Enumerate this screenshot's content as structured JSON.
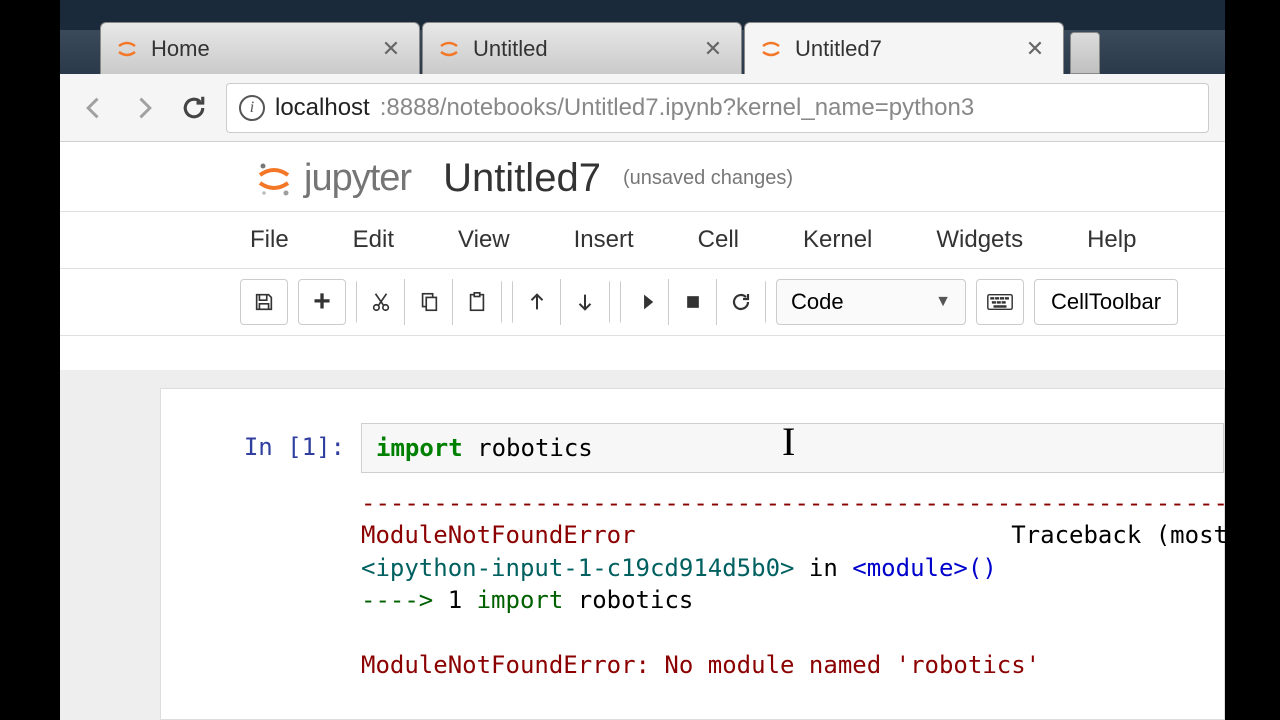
{
  "browser": {
    "tabs": [
      {
        "title": "Home",
        "active": false
      },
      {
        "title": "Untitled",
        "active": false
      },
      {
        "title": "Untitled7",
        "active": true
      }
    ],
    "url_host": "localhost",
    "url_port_path": ":8888/notebooks/Untitled7.ipynb?kernel_name=python3"
  },
  "notebook": {
    "brand": "jupyter",
    "title": "Untitled7",
    "subtitle": "(unsaved changes)",
    "menu": [
      "File",
      "Edit",
      "View",
      "Insert",
      "Cell",
      "Kernel",
      "Widgets",
      "Help"
    ],
    "cell_type_selected": "Code",
    "cell_toolbar_label": "CellToolbar"
  },
  "cell": {
    "prompt": "In [1]:",
    "code_keyword": "import",
    "code_rest": " robotics",
    "output": {
      "dashline": "---------------------------------------------------------------",
      "err_name": "ModuleNotFoundError",
      "traceback_right": "Traceback (most",
      "line2_a": "<ipython-input-1-c19cd914d5b0>",
      "line2_b": " in ",
      "line2_c": "<module>",
      "line2_d": "()",
      "line3_arrow": "----> ",
      "line3_num": "1",
      "line3_kw": " import ",
      "line3_rest": "robotics",
      "final": "ModuleNotFoundError: No module named 'robotics'"
    }
  }
}
